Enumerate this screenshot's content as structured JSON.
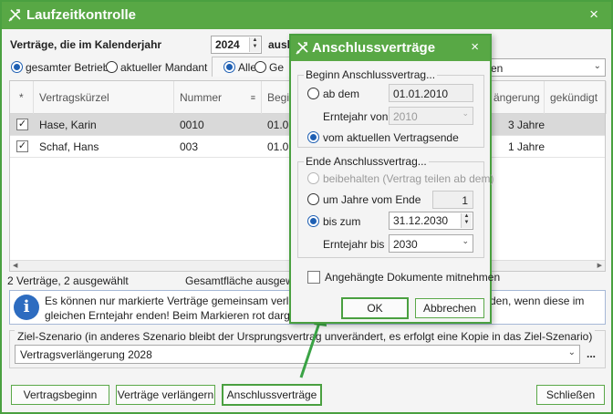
{
  "window": {
    "title": "Laufzeitkontrolle",
    "close": "×"
  },
  "top": {
    "label_prefix": "Verträge, die im Kalenderjahr",
    "year": "2024",
    "label_suffix": "ausl"
  },
  "scope": {
    "option1": "gesamter Betrieb",
    "option2": "aktueller Mandant",
    "option3": "Alle",
    "option4": "Ge",
    "combo_text": "en"
  },
  "grid": {
    "columns": [
      "*",
      "Vertragskürzel",
      "Nummer",
      "Begi",
      "ängerung",
      "gekündigt"
    ],
    "rows": [
      {
        "name": "Hase, Karin",
        "nummer": "0010",
        "beginn": "01.01",
        "verl": "3 Jahre"
      },
      {
        "name": "Schaf, Hans",
        "nummer": "003",
        "beginn": "01.01",
        "verl": "1 Jahre"
      }
    ]
  },
  "status": {
    "count": "2 Verträge, 2 ausgewählt",
    "area": "Gesamtfläche ausgewä"
  },
  "info": {
    "line1_left": "Es können nur markierte Verträge gemeinsam verlänger",
    "line1_right": "den, wenn diese im",
    "line2_left": "gleichen Erntejahr enden! Beim Markieren rot dargestell"
  },
  "zielszenario": {
    "label": "Ziel-Szenario (in anderes Szenario bleibt der Ursprungsvertrag unverändert, es erfolgt eine Kopie in das Ziel-Szenario)",
    "value": "Vertragsverlängerung 2028",
    "more": "..."
  },
  "buttons": {
    "vertragsbeginn": "Vertragsbeginn",
    "verlaengern": "Verträge verlängern",
    "anschluss": "Anschlussverträge",
    "schliessen": "Schließen"
  },
  "dialog": {
    "title": "Anschlussverträge",
    "close": "×",
    "beginn_group": "Beginn Anschlussvertrag...",
    "ab_dem": "ab dem",
    "ab_dem_date": "01.01.2010",
    "erntejahr_von_label": "Erntejahr von",
    "erntejahr_von": "2010",
    "vom_aktuellen": "vom aktuellen Vertragsende",
    "ende_group": "Ende Anschlussvertrag...",
    "beibehalten": "beibehalten (Vertrag teilen ab dem)",
    "um_jahre": "um Jahre vom Ende",
    "um_jahre_value": "1",
    "bis_zum": "bis zum",
    "bis_zum_date": "31.12.2030",
    "erntejahr_bis_label": "Erntejahr bis",
    "erntejahr_bis": "2030",
    "dokumente": "Angehängte Dokumente mitnehmen",
    "ok": "OK",
    "abbrechen": "Abbrechen"
  },
  "colors": {
    "accent": "#58a845",
    "radio": "#1e5fb3",
    "arrow": "#3aa345"
  }
}
